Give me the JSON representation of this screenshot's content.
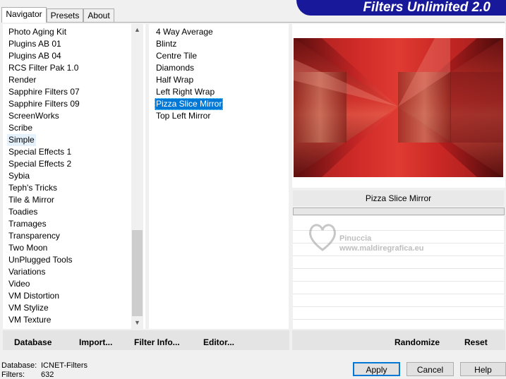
{
  "tabs": [
    {
      "label": "Navigator",
      "active": true
    },
    {
      "label": "Presets",
      "active": false
    },
    {
      "label": "About",
      "active": false
    }
  ],
  "banner": {
    "title": "Filters Unlimited 2.0"
  },
  "categories": [
    "Photo Aging Kit",
    "Plugins AB 01",
    "Plugins AB 04",
    "RCS Filter Pak 1.0",
    "Render",
    "Sapphire Filters 07",
    "Sapphire Filters 09",
    "ScreenWorks",
    "Scribe",
    "Simple",
    "Special Effects 1",
    "Special Effects 2",
    "Sybia",
    "Teph's Tricks",
    "Tile & Mirror",
    "Toadies",
    "Tramages",
    "Transparency",
    "Two Moon",
    "UnPlugged Tools",
    "Variations",
    "Video",
    "VM Distortion",
    "VM Stylize",
    "VM Texture"
  ],
  "selected_category": "Simple",
  "filters": [
    "4 Way Average",
    "Blintz",
    "Centre Tile",
    "Diamonds",
    "Half Wrap",
    "Left Right Wrap",
    "Pizza Slice Mirror",
    "Top Left Mirror"
  ],
  "selected_filter": "Pizza Slice Mirror",
  "preview": {
    "filter_name": "Pizza Slice Mirror"
  },
  "watermark": {
    "name": "Pinuccia",
    "url": "www.maldiregrafica.eu"
  },
  "toolbar": {
    "database": "Database",
    "import": "Import...",
    "filter_info": "Filter Info...",
    "editor": "Editor...",
    "randomize": "Randomize",
    "reset": "Reset"
  },
  "status": {
    "database_label": "Database:",
    "database_value": "ICNET-Filters",
    "filters_label": "Filters:",
    "filters_value": "632"
  },
  "dialog": {
    "apply": "Apply",
    "cancel": "Cancel",
    "help": "Help"
  },
  "colors": {
    "accent": "#0078d7",
    "banner": "#18189a"
  }
}
